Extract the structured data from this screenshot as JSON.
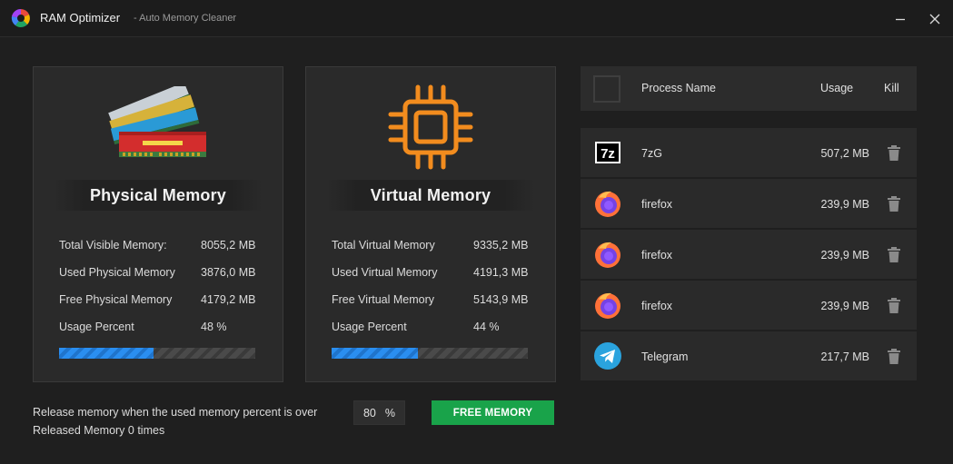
{
  "app": {
    "title": "RAM Optimizer",
    "subtitle": "-  Auto Memory Cleaner"
  },
  "physical": {
    "heading": "Physical Memory",
    "stats": [
      {
        "label": "Total Visible Memory:",
        "value": "8055,2 MB"
      },
      {
        "label": "Used Physical Memory",
        "value": "3876,0 MB"
      },
      {
        "label": "Free Physical Memory",
        "value": "4179,2 MB"
      },
      {
        "label": "Usage Percent",
        "value": "48  %"
      }
    ],
    "usage_fraction": 0.48
  },
  "virtual": {
    "heading": "Virtual Memory",
    "stats": [
      {
        "label": "Total Virtual Memory",
        "value": "9335,2 MB"
      },
      {
        "label": "Used Virtual Memory",
        "value": "4191,3 MB"
      },
      {
        "label": "Free Virtual Memory",
        "value": "5143,9 MB"
      },
      {
        "label": "Usage Percent",
        "value": "44  %"
      }
    ],
    "usage_fraction": 0.44
  },
  "release": {
    "text": "Release memory when the used memory percent is over",
    "threshold": "80",
    "unit": "%",
    "count_text": "Released Memory 0 times",
    "button": "FREE MEMORY"
  },
  "process_table": {
    "headers": {
      "name": "Process Name",
      "usage": "Usage",
      "kill": "Kill"
    },
    "rows": [
      {
        "name": "7zG",
        "usage": "507,2 MB",
        "icon": "7zip-icon"
      },
      {
        "name": "firefox",
        "usage": "239,9 MB",
        "icon": "firefox-icon"
      },
      {
        "name": "firefox",
        "usage": "239,9 MB",
        "icon": "firefox-icon"
      },
      {
        "name": "firefox",
        "usage": "239,9 MB",
        "icon": "firefox-icon"
      },
      {
        "name": "Telegram",
        "usage": "217,7 MB",
        "icon": "telegram-icon"
      }
    ]
  },
  "colors": {
    "background": "#1f1f1f",
    "card": "#2a2a2a",
    "accent_blue": "#2a8ef0",
    "button_green": "#19a34a",
    "cpu_orange": "#f28c1e"
  }
}
